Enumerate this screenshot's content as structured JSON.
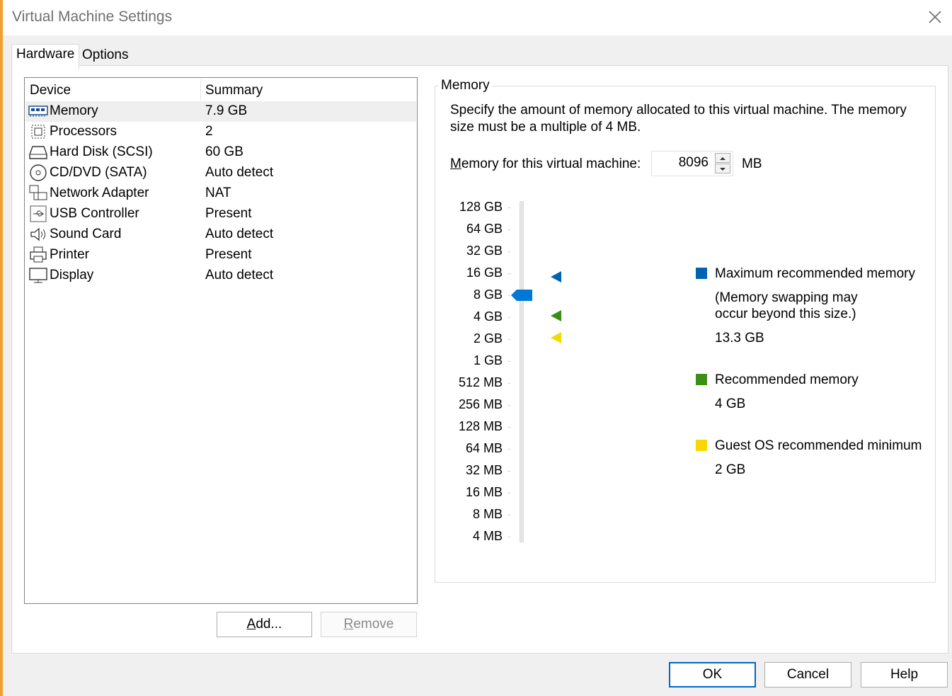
{
  "window": {
    "title": "Virtual Machine Settings"
  },
  "tabs": [
    {
      "label": "Hardware"
    },
    {
      "label": "Options"
    }
  ],
  "device_list": {
    "headers": {
      "device": "Device",
      "summary": "Summary"
    },
    "rows": [
      {
        "name": "Memory",
        "summary": "7.9 GB",
        "icon": "memory-icon"
      },
      {
        "name": "Processors",
        "summary": "2",
        "icon": "processor-icon"
      },
      {
        "name": "Hard Disk (SCSI)",
        "summary": "60 GB",
        "icon": "hard-disk-icon"
      },
      {
        "name": "CD/DVD (SATA)",
        "summary": "Auto detect",
        "icon": "cd-dvd-icon"
      },
      {
        "name": "Network Adapter",
        "summary": "NAT",
        "icon": "network-adapter-icon"
      },
      {
        "name": "USB Controller",
        "summary": "Present",
        "icon": "usb-icon"
      },
      {
        "name": "Sound Card",
        "summary": "Auto detect",
        "icon": "speaker-icon"
      },
      {
        "name": "Printer",
        "summary": "Present",
        "icon": "printer-icon"
      },
      {
        "name": "Display",
        "summary": "Auto detect",
        "icon": "display-icon"
      }
    ]
  },
  "buttons": {
    "add": "Add...",
    "remove": "Remove",
    "ok": "OK",
    "cancel": "Cancel",
    "help": "Help"
  },
  "memory": {
    "group_title": "Memory",
    "description": "Specify the amount of memory allocated to this virtual machine. The memory size must be a multiple of 4 MB.",
    "field_label_prefix": "M",
    "field_label_rest": "emory for this virtual machine:",
    "value": "8096",
    "unit": "MB",
    "scale": [
      "128 GB",
      "64 GB",
      "32 GB",
      "16 GB",
      "8 GB",
      "4 GB",
      "2 GB",
      "1 GB",
      "512 MB",
      "256 MB",
      "128 MB",
      "64 MB",
      "32 MB",
      "16 MB",
      "8 MB",
      "4 MB"
    ],
    "legend": {
      "max_label": "Maximum recommended memory",
      "max_note_line1": "(Memory swapping may",
      "max_note_line2": "occur beyond this size.)",
      "max_value": "13.3 GB",
      "rec_label": "Recommended memory",
      "rec_value": "4 GB",
      "min_label": "Guest OS recommended minimum",
      "min_value": "2 GB"
    },
    "colors": {
      "max": "#0063b1",
      "rec": "#3c8f16",
      "min": "#f5d800",
      "slider": "#0078d7"
    }
  }
}
